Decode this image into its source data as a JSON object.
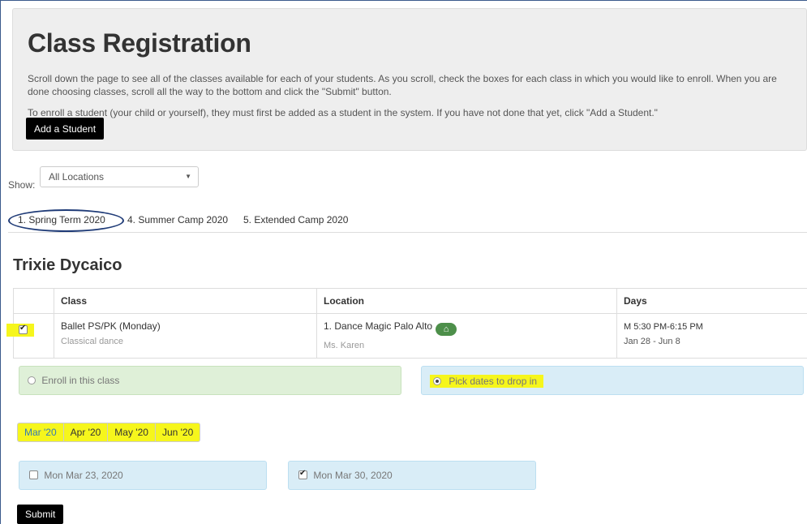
{
  "header": {
    "title": "Class Registration",
    "intro": "Scroll down the page to see all of the classes available for each of your students. As you scroll, check the boxes for each class in which you would like to enroll. When you are done choosing classes, scroll all the way to the bottom and click the \"Submit\" button.",
    "instructions": "To enroll a student (your child or yourself), they must first be added as a student in the system. If you have not done that yet, click \"Add a Student.\"",
    "add_student_label": "Add a Student"
  },
  "filter": {
    "show_label": "Show:",
    "location_value": "All Locations"
  },
  "terms": [
    {
      "label": "1. Spring Term 2020",
      "active": true
    },
    {
      "label": "4. Summer Camp 2020",
      "active": false
    },
    {
      "label": "5. Extended Camp 2020",
      "active": false
    }
  ],
  "student": {
    "name": "Trixie Dycaico"
  },
  "table": {
    "headers": [
      "",
      "Class",
      "Location",
      "Days"
    ],
    "row": {
      "checked": true,
      "class_name": "Ballet PS/PK (Monday)",
      "class_desc": "Classical dance",
      "location": "1. Dance Magic Palo Alto",
      "location_icon": "home-icon",
      "teacher": "Ms. Karen",
      "time": "M 5:30 PM-6:15 PM",
      "dates": "Jan 28 - Jun 8"
    }
  },
  "options": {
    "enroll_label": "Enroll in this class",
    "dropin_label": "Pick dates to drop in",
    "selected": "dropin"
  },
  "months": [
    "Mar '20",
    "Apr '20",
    "May '20",
    "Jun '20"
  ],
  "dates": [
    {
      "label": "Mon Mar 23, 2020",
      "checked": false
    },
    {
      "label": "Mon Mar 30, 2020",
      "checked": true
    }
  ],
  "submit_label": "Submit",
  "colors": {
    "highlight": "#f6f61c",
    "enroll_bg": "#dff0d8",
    "dropin_bg": "#d9edf7",
    "home_badge": "#4d8f4a",
    "tab_circle": "#1f3b77"
  }
}
